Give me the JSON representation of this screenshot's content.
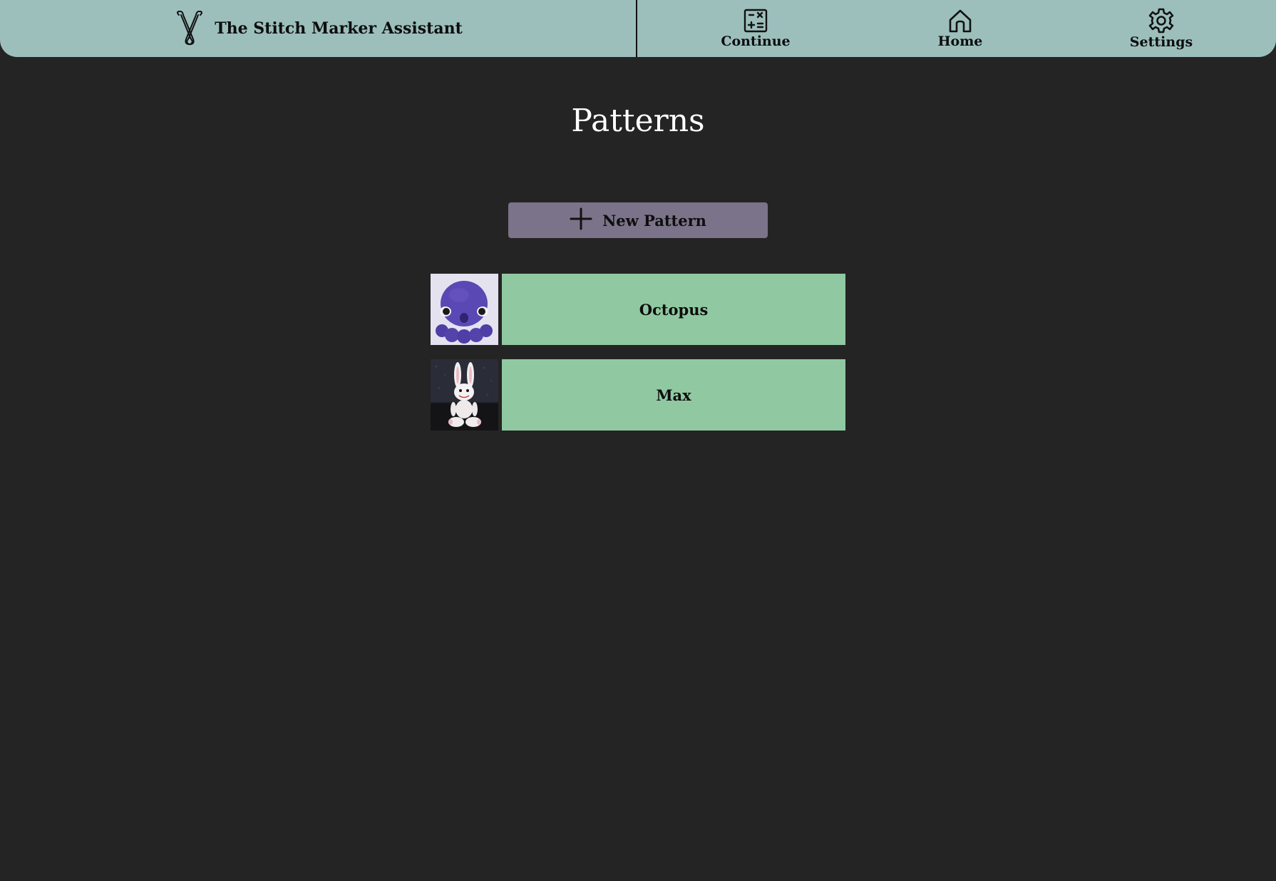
{
  "app": {
    "title": "The Stitch Marker Assistant",
    "logo_icon": "stitch-marker-icon"
  },
  "nav": {
    "items": [
      {
        "label": "Continue",
        "icon": "calculator-icon"
      },
      {
        "label": "Home",
        "icon": "home-icon"
      },
      {
        "label": "Settings",
        "icon": "gear-icon"
      }
    ]
  },
  "main": {
    "title": "Patterns",
    "new_button": {
      "label": "New Pattern",
      "icon": "plus-icon"
    },
    "patterns": [
      {
        "name": "Octopus",
        "thumbnail": "purple crochet octopus photo"
      },
      {
        "name": "Max",
        "thumbnail": "white crochet bunny photo"
      }
    ]
  },
  "colors": {
    "background": "#242424",
    "topbar": "#9cbfbc",
    "button": "#7b7389",
    "pattern_row": "#90c9a1",
    "text_dark": "#0d0d0d",
    "title_text": "#ffffff"
  }
}
